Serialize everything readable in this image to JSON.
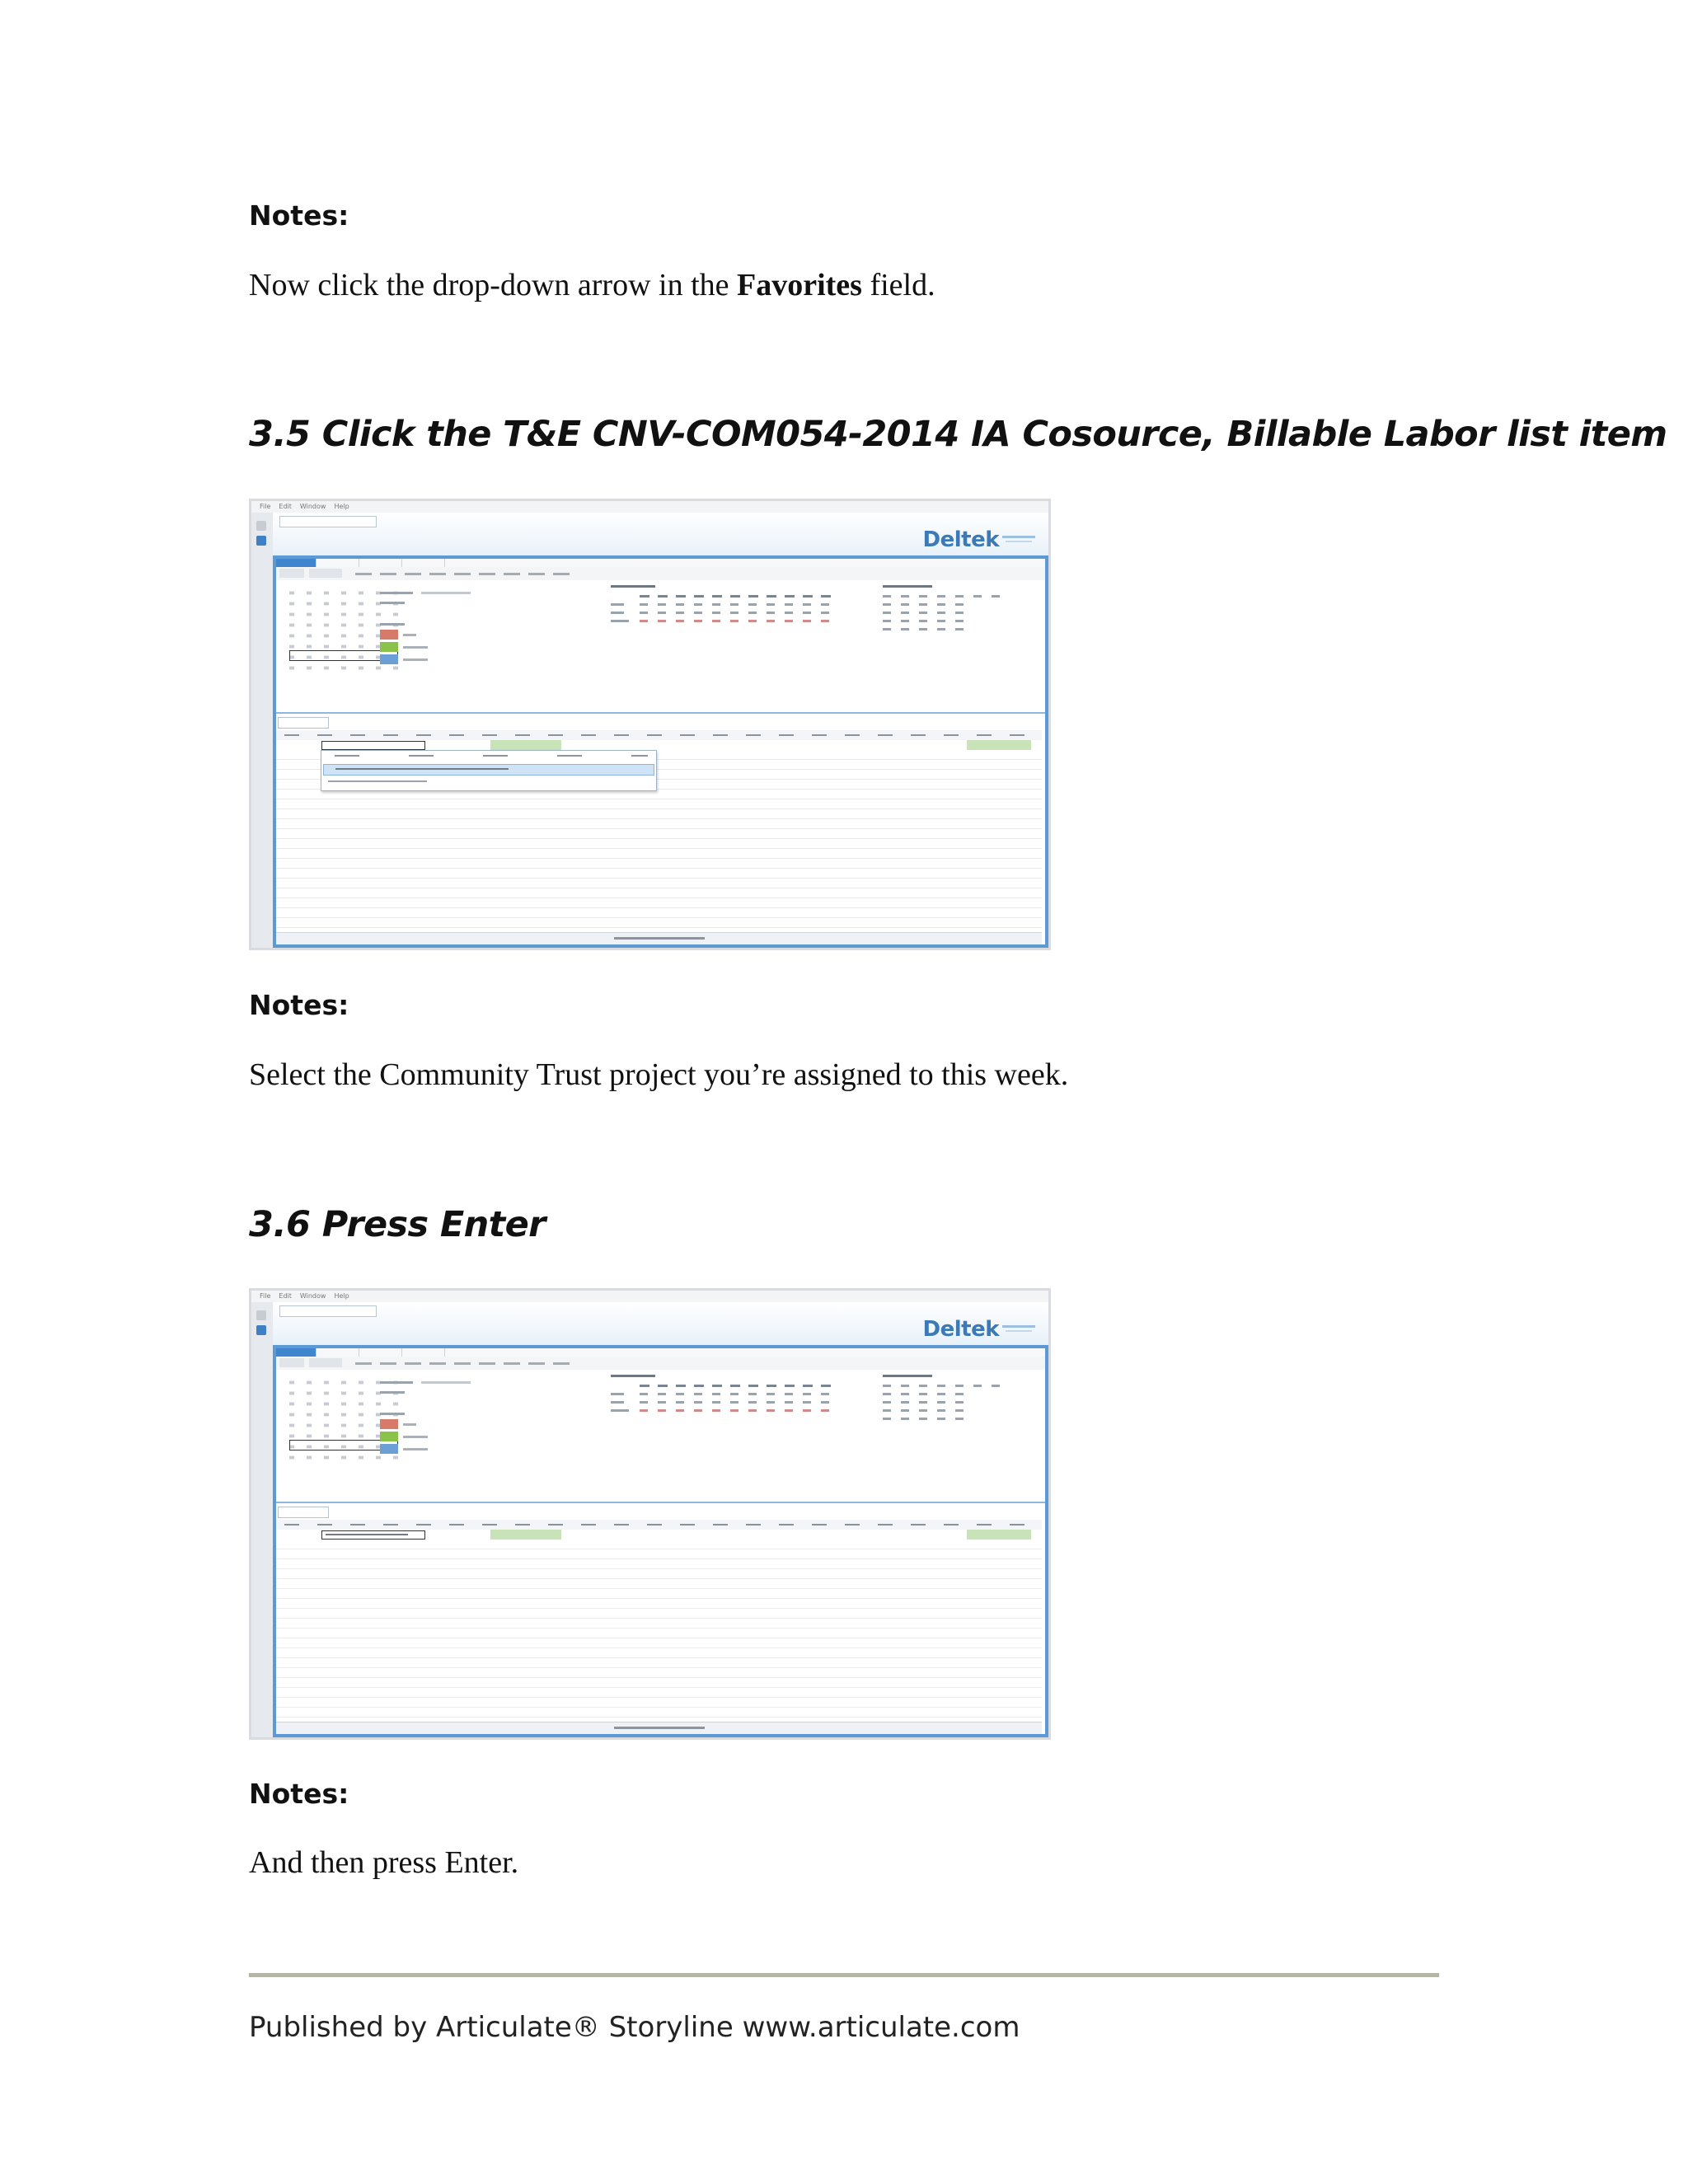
{
  "section_a": {
    "notes_heading": "Notes:",
    "note_text_before": "Now click the drop-down arrow in the ",
    "note_text_bold": "Favorites",
    "note_text_after": " field."
  },
  "step_35": {
    "heading": "3.5 Click the T&E CNV-COM054-2014 IA Cosource, Billable Labor list item",
    "notes_heading": "Notes:",
    "note_text": "Select the Community  Trust project you’re assigned to this week."
  },
  "step_36": {
    "heading": "3.6 Press Enter",
    "notes_heading": "Notes:",
    "note_text": "And then press Enter."
  },
  "screenshot": {
    "brand": "Deltek",
    "menu": [
      "File",
      "Edit",
      "Window",
      "Help"
    ],
    "colors": {
      "accent_blue": "#5d9ad3",
      "brand_blue": "#3b79b7",
      "legend_due": "#d77a6a",
      "legend_submitted": "#8bc34a",
      "legend_approved": "#6c9fd6"
    }
  },
  "footer": {
    "text": "Published by Articulate® Storyline www.articulate.com"
  }
}
